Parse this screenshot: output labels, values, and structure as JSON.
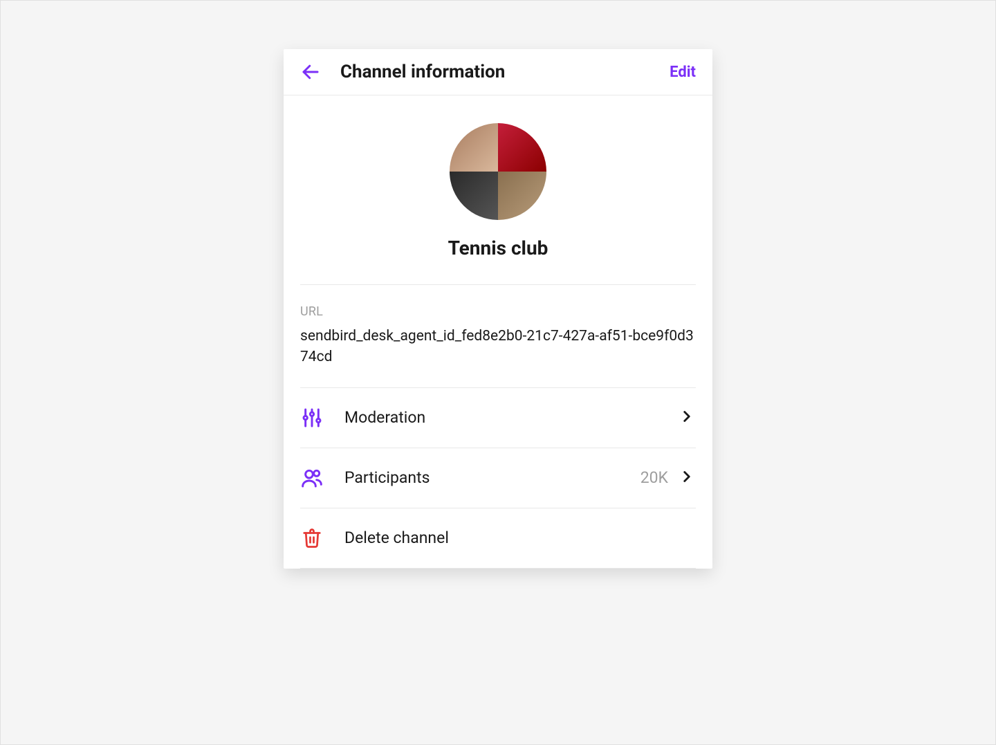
{
  "header": {
    "title": "Channel information",
    "edit_label": "Edit"
  },
  "channel": {
    "name": "Tennis club"
  },
  "url": {
    "label": "URL",
    "value": "sendbird_desk_agent_id_fed8e2b0-21c7-427a-af51-bce9f0d374cd"
  },
  "rows": {
    "moderation": {
      "label": "Moderation"
    },
    "participants": {
      "label": "Participants",
      "count": "20K"
    },
    "delete": {
      "label": "Delete channel"
    }
  }
}
